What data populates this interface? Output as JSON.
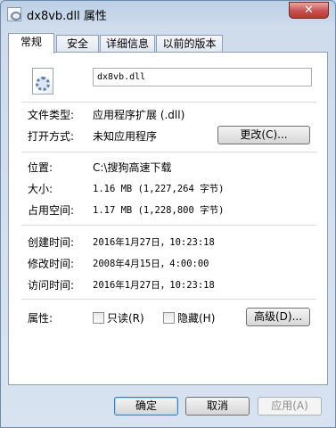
{
  "window": {
    "title": "dx8vb.dll 属性",
    "close_label": "✕"
  },
  "tabs": [
    {
      "label": "常规"
    },
    {
      "label": "安全"
    },
    {
      "label": "详细信息"
    },
    {
      "label": "以前的版本"
    }
  ],
  "general": {
    "filename": "dx8vb.dll",
    "file_type_label": "文件类型:",
    "file_type_value": "应用程序扩展 (.dll)",
    "open_with_label": "打开方式:",
    "open_with_value": "未知应用程序",
    "change_button": "更改(C)...",
    "location_label": "位置:",
    "location_value": "C:\\搜狗高速下载",
    "size_label": "大小:",
    "size_value": "1.16 MB (1,227,264 字节)",
    "size_on_disk_label": "占用空间:",
    "size_on_disk_value": "1.17 MB (1,228,800 字节)",
    "created_label": "创建时间:",
    "created_value": "2016年1月27日，10:23:18",
    "modified_label": "修改时间:",
    "modified_value": "2008年4月15日，4:00:00",
    "accessed_label": "访问时间:",
    "accessed_value": "2016年1月27日，10:23:18",
    "attributes_label": "属性:",
    "readonly_label": "只读(R)",
    "hidden_label": "隐藏(H)",
    "advanced_button": "高级(D)..."
  },
  "footer": {
    "ok": "确定",
    "cancel": "取消",
    "apply": "应用(A)"
  }
}
